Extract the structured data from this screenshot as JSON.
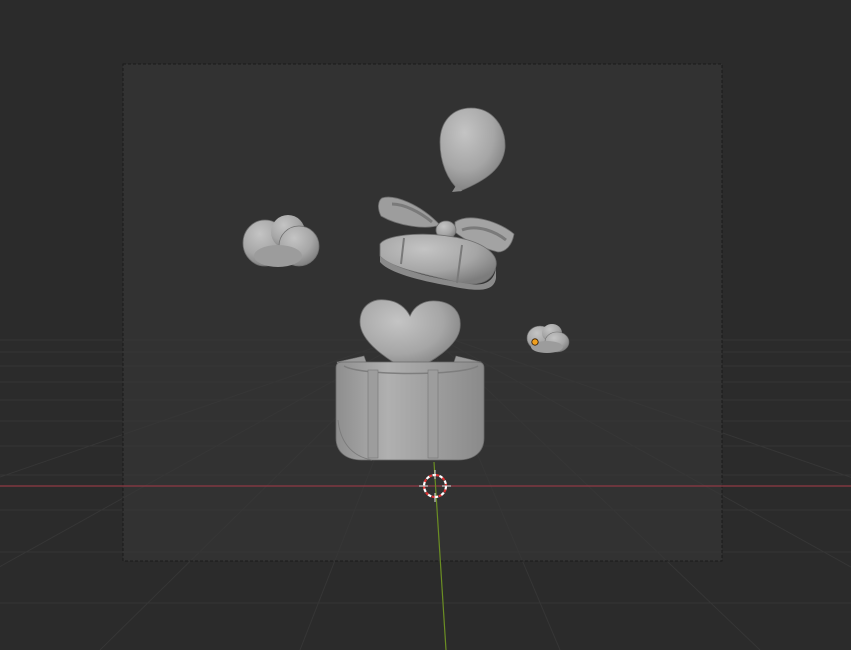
{
  "viewport": {
    "mode": "camera-view",
    "shading": "solid",
    "background_color": "#2b2b2b",
    "camera_frame_inner_color": "#363636",
    "grid_line_color": "#3a3a3a",
    "x_axis_color": "#9a3a44",
    "y_axis_color": "#6b8e23",
    "object_color": "#a9a9a9",
    "origin_dot_color": "#f0a020"
  },
  "scene": {
    "objects": [
      {
        "name": "balloon",
        "type": "mesh"
      },
      {
        "name": "gift-lid-with-bow",
        "type": "mesh"
      },
      {
        "name": "cloud-left",
        "type": "mesh"
      },
      {
        "name": "cloud-right",
        "type": "mesh",
        "selected": true
      },
      {
        "name": "heart",
        "type": "mesh"
      },
      {
        "name": "gift-box",
        "type": "mesh"
      }
    ],
    "cursor_3d": {
      "visible": true
    }
  }
}
